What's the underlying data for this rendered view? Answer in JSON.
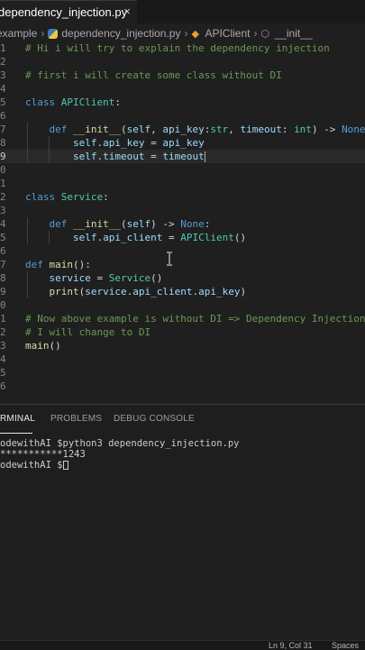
{
  "tab": {
    "label": "dependency_injection.py",
    "close_glyph": "×"
  },
  "breadcrumb": {
    "items": [
      "example",
      "dependency_injection.py",
      "APIClient",
      "__init__"
    ],
    "separator": "›"
  },
  "editor": {
    "line_numbers": [
      "1",
      "2",
      "3",
      "4",
      "5",
      "6",
      "7",
      "8",
      "9",
      "0",
      "1",
      "2",
      "3",
      "4",
      "5",
      "6",
      "7",
      "8",
      "9",
      "0",
      "1",
      "2",
      "3",
      "4",
      "5",
      "6"
    ],
    "active_line_number": "9",
    "lines": [
      [
        {
          "c": "t-comment",
          "t": "# Hi i will try to explain the dependency injection"
        }
      ],
      [],
      [
        {
          "c": "t-comment",
          "t": "# first i will create some class without DI"
        }
      ],
      [],
      [
        {
          "c": "t-kw",
          "t": "class "
        },
        {
          "c": "t-cls",
          "t": "APIClient"
        },
        {
          "c": "t-plain",
          "t": ":"
        }
      ],
      [],
      [
        {
          "c": "t-kw",
          "t": "    def "
        },
        {
          "c": "t-fn",
          "t": "__init__"
        },
        {
          "c": "t-plain",
          "t": "("
        },
        {
          "c": "t-var",
          "t": "self"
        },
        {
          "c": "t-plain",
          "t": ", "
        },
        {
          "c": "t-var",
          "t": "api_key"
        },
        {
          "c": "t-plain",
          "t": ":"
        },
        {
          "c": "t-cls",
          "t": "str"
        },
        {
          "c": "t-plain",
          "t": ", "
        },
        {
          "c": "t-var",
          "t": "timeout"
        },
        {
          "c": "t-plain",
          "t": ": "
        },
        {
          "c": "t-cls",
          "t": "int"
        },
        {
          "c": "t-plain",
          "t": ") -> "
        },
        {
          "c": "t-const",
          "t": "None"
        },
        {
          "c": "t-plain",
          "t": ":"
        }
      ],
      [
        {
          "c": "t-var",
          "t": "        self"
        },
        {
          "c": "t-plain",
          "t": "."
        },
        {
          "c": "t-var",
          "t": "api_key"
        },
        {
          "c": "t-plain",
          "t": " = "
        },
        {
          "c": "t-var",
          "t": "api_key"
        }
      ],
      [
        {
          "c": "t-var",
          "t": "        self"
        },
        {
          "c": "t-plain",
          "t": "."
        },
        {
          "c": "t-var",
          "t": "timeout"
        },
        {
          "c": "t-plain",
          "t": " = "
        },
        {
          "c": "t-var",
          "t": "timeout"
        }
      ],
      [],
      [],
      [
        {
          "c": "t-kw",
          "t": "class "
        },
        {
          "c": "t-cls",
          "t": "Service"
        },
        {
          "c": "t-plain",
          "t": ":"
        }
      ],
      [],
      [
        {
          "c": "t-kw",
          "t": "    def "
        },
        {
          "c": "t-fn",
          "t": "__init__"
        },
        {
          "c": "t-plain",
          "t": "("
        },
        {
          "c": "t-var",
          "t": "self"
        },
        {
          "c": "t-plain",
          "t": ") -> "
        },
        {
          "c": "t-const",
          "t": "None"
        },
        {
          "c": "t-plain",
          "t": ":"
        }
      ],
      [
        {
          "c": "t-var",
          "t": "        self"
        },
        {
          "c": "t-plain",
          "t": "."
        },
        {
          "c": "t-var",
          "t": "api_client"
        },
        {
          "c": "t-plain",
          "t": " = "
        },
        {
          "c": "t-cls",
          "t": "APIClient"
        },
        {
          "c": "t-plain",
          "t": "()"
        }
      ],
      [],
      [
        {
          "c": "t-kw",
          "t": "def "
        },
        {
          "c": "t-fn",
          "t": "main"
        },
        {
          "c": "t-plain",
          "t": "():"
        }
      ],
      [
        {
          "c": "t-var",
          "t": "    service"
        },
        {
          "c": "t-plain",
          "t": " = "
        },
        {
          "c": "t-cls",
          "t": "Service"
        },
        {
          "c": "t-plain",
          "t": "()"
        }
      ],
      [
        {
          "c": "t-fn",
          "t": "    print"
        },
        {
          "c": "t-plain",
          "t": "("
        },
        {
          "c": "t-var",
          "t": "service"
        },
        {
          "c": "t-plain",
          "t": "."
        },
        {
          "c": "t-var",
          "t": "api_client"
        },
        {
          "c": "t-plain",
          "t": "."
        },
        {
          "c": "t-var",
          "t": "api_key"
        },
        {
          "c": "t-plain",
          "t": ")"
        }
      ],
      [],
      [
        {
          "c": "t-comment",
          "t": "# Now above example is without DI => Dependency Injection"
        }
      ],
      [
        {
          "c": "t-comment",
          "t": "# I will change to DI"
        }
      ],
      [
        {
          "c": "t-fn",
          "t": "main"
        },
        {
          "c": "t-plain",
          "t": "()"
        }
      ],
      [],
      [],
      []
    ]
  },
  "panel": {
    "tabs": [
      "RMINAL",
      "PROBLEMS",
      "DEBUG CONSOLE"
    ],
    "active_tab_index": 0,
    "terminal_lines": [
      "odewithAI $python3 dependency_injection.py",
      "***********1243",
      "odewithAI $"
    ]
  },
  "status": {
    "position": "Ln 9, Col 31",
    "spaces": "Spaces"
  },
  "colors": {
    "editor_bg": "#1f1f1f",
    "comment": "#6a9955",
    "keyword": "#569cd6",
    "class_name": "#4ec9b0",
    "function": "#dcdcaa",
    "variable": "#9cdcfe"
  }
}
